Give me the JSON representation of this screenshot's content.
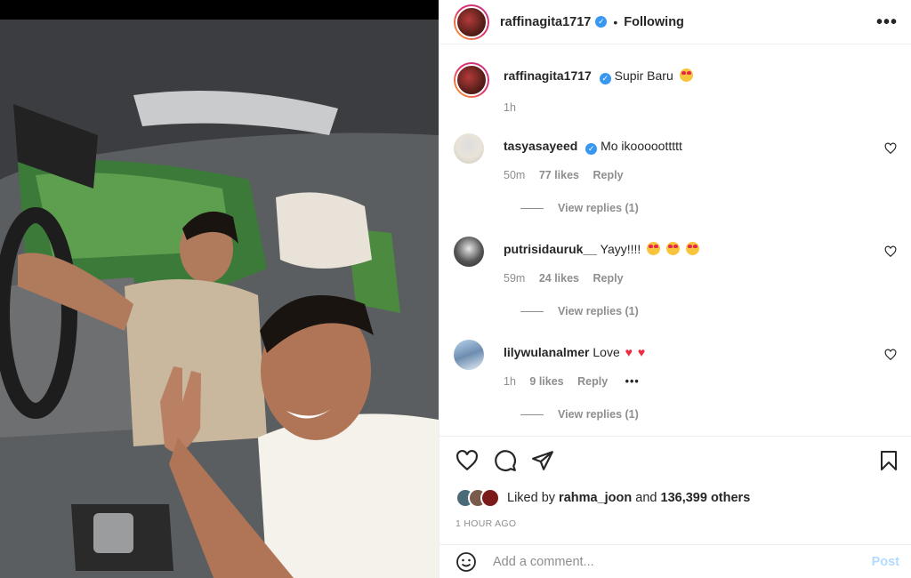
{
  "post": {
    "author": "raffinagita1717",
    "follow_status": "Following",
    "separator": "•",
    "more_icon": "more-horizontal-icon",
    "caption": "Supir Baru",
    "caption_time": "1h",
    "verified_mark": "✓",
    "brand_blue": "#3897f0"
  },
  "comments": [
    {
      "user": "tasyasayeed",
      "verified": true,
      "text": "Mo ikooooottttt",
      "time": "50m",
      "likes": "77 likes",
      "reply": "Reply",
      "view_replies": "View replies (1)"
    },
    {
      "user": "putrisidauruk__",
      "verified": false,
      "text": "Yayy!!!!",
      "time": "59m",
      "likes": "24 likes",
      "reply": "Reply",
      "view_replies": "View replies (1)"
    },
    {
      "user": "lilywulanalmer",
      "verified": false,
      "text": "Love",
      "time": "1h",
      "likes": "9 likes",
      "reply": "Reply",
      "view_replies": "View replies (1)",
      "more": "•••"
    }
  ],
  "actions": {
    "liked_by_prefix": "Liked by",
    "liked_by_user": "rahma_joon",
    "liked_by_and": "and",
    "liked_by_others": "136,399 others",
    "timestamp": "1 HOUR AGO"
  },
  "add_comment": {
    "placeholder": "Add a comment...",
    "post_label": "Post"
  }
}
